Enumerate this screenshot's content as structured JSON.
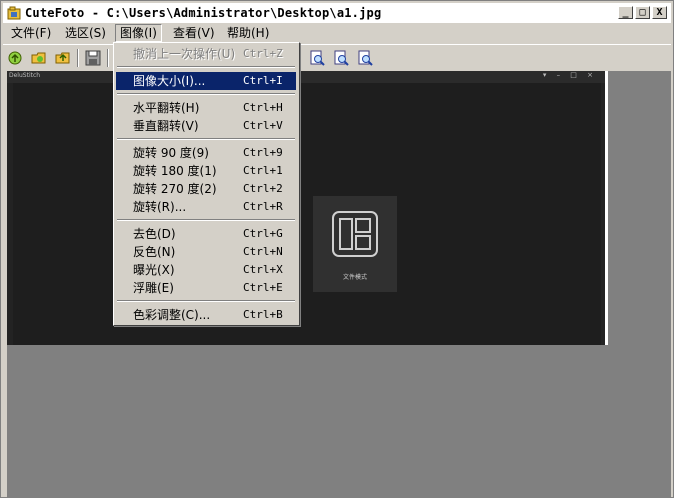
{
  "window": {
    "title": "CuteFoto - C:\\Users\\Administrator\\Desktop\\a1.jpg",
    "controls": {
      "minimize": "_",
      "maximize": "□",
      "close": "X"
    }
  },
  "menubar": {
    "items": [
      {
        "label": "文件(F)"
      },
      {
        "label": "选区(S)"
      },
      {
        "label": "图像(I)",
        "open": true
      },
      {
        "label": "查看(V)"
      },
      {
        "label": "帮助(H)"
      }
    ]
  },
  "image_menu": {
    "items": [
      {
        "label": "撤消上一次操作(U)",
        "shortcut": "Ctrl+Z",
        "disabled": true
      },
      {
        "label": "图像大小(I)...",
        "shortcut": "Ctrl+I",
        "selected": true
      },
      {
        "label": "水平翻转(H)",
        "shortcut": "Ctrl+H"
      },
      {
        "label": "垂直翻转(V)",
        "shortcut": "Ctrl+V"
      },
      {
        "label": "旋转 90 度(9)",
        "shortcut": "Ctrl+9"
      },
      {
        "label": "旋转 180 度(1)",
        "shortcut": "Ctrl+1"
      },
      {
        "label": "旋转 270 度(2)",
        "shortcut": "Ctrl+2"
      },
      {
        "label": "旋转(R)...",
        "shortcut": "Ctrl+R"
      },
      {
        "label": "去色(D)",
        "shortcut": "Ctrl+G"
      },
      {
        "label": "反色(N)",
        "shortcut": "Ctrl+N"
      },
      {
        "label": "曝光(X)",
        "shortcut": "Ctrl+X"
      },
      {
        "label": "浮雕(E)",
        "shortcut": "Ctrl+E"
      },
      {
        "label": "色彩调整(C)...",
        "shortcut": "Ctrl+B"
      }
    ]
  },
  "toolbar": {
    "icons": [
      "new-icon",
      "open-icon",
      "open-folder-icon",
      "save-icon",
      "zoom-in-icon",
      "zoom-out-icon",
      "zoom-fit-icon"
    ]
  },
  "image_content": {
    "app_title": "DeluStitch",
    "window_controls": "▾ – □ ×",
    "mode_label": "文件模式"
  },
  "colors": {
    "menu_bg": "#d4d0c8",
    "selection": "#0a246a",
    "canvas": "#808080",
    "image_bg": "#232323"
  }
}
